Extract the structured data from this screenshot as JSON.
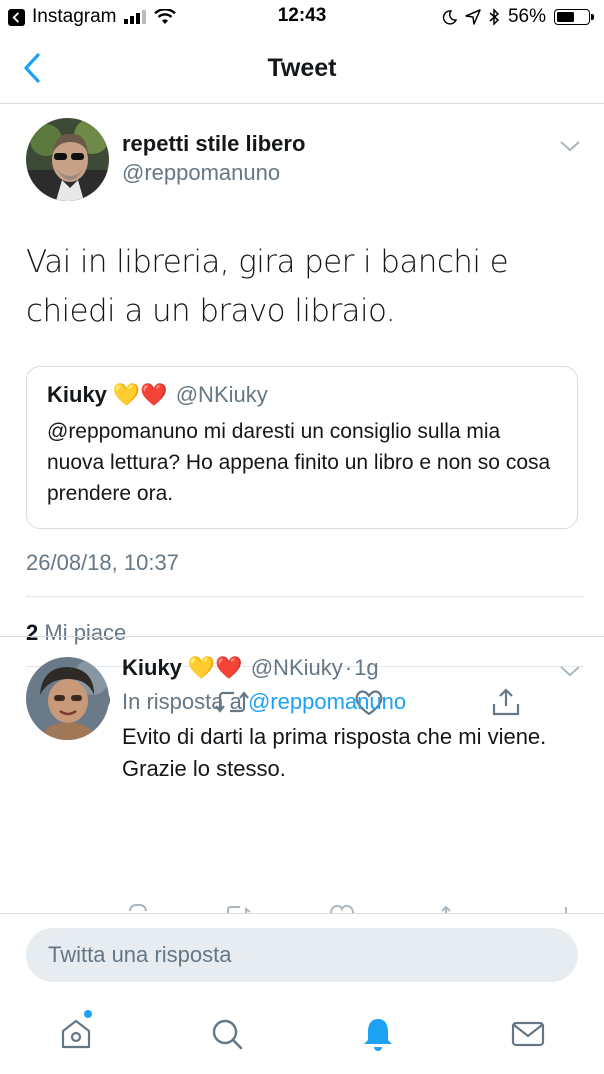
{
  "status_bar": {
    "app_name": "Instagram",
    "time": "12:43",
    "battery_percent": "56%",
    "battery_level": 0.56
  },
  "nav": {
    "title": "Tweet"
  },
  "tweet": {
    "author_name": "repetti stile libero",
    "author_handle": "@reppomanuno",
    "text": "Vai in libreria, gira per i banchi e chiedi a un bravo libraio.",
    "quote": {
      "name": "Kiuky",
      "emojis": "💛❤️",
      "handle": "@NKiuky",
      "text": "@reppomanuno mi daresti un consiglio sulla mia nuova lettura? Ho appena finito un libro e non so cosa prendere ora."
    },
    "timestamp": "26/08/18, 10:37",
    "likes_count": "2",
    "likes_label": "Mi piace"
  },
  "reply": {
    "name": "Kiuky",
    "emojis": "💛❤️",
    "handle": "@NKiuky",
    "separator": "·",
    "age": "1g",
    "in_reply_label": "In risposta a",
    "in_reply_handle": "@reppomanuno",
    "text": "Evito di darti la prima risposta che mi viene. Grazie lo stesso."
  },
  "composer": {
    "placeholder": "Twitta una risposta"
  },
  "colors": {
    "accent": "#1da1f2",
    "secondary_text": "#657786",
    "border": "#d8dde2"
  },
  "icons": [
    "back-chevron-icon",
    "reply-icon",
    "retweet-icon",
    "like-icon",
    "share-icon",
    "home-icon",
    "search-icon",
    "notifications-icon",
    "messages-icon"
  ]
}
